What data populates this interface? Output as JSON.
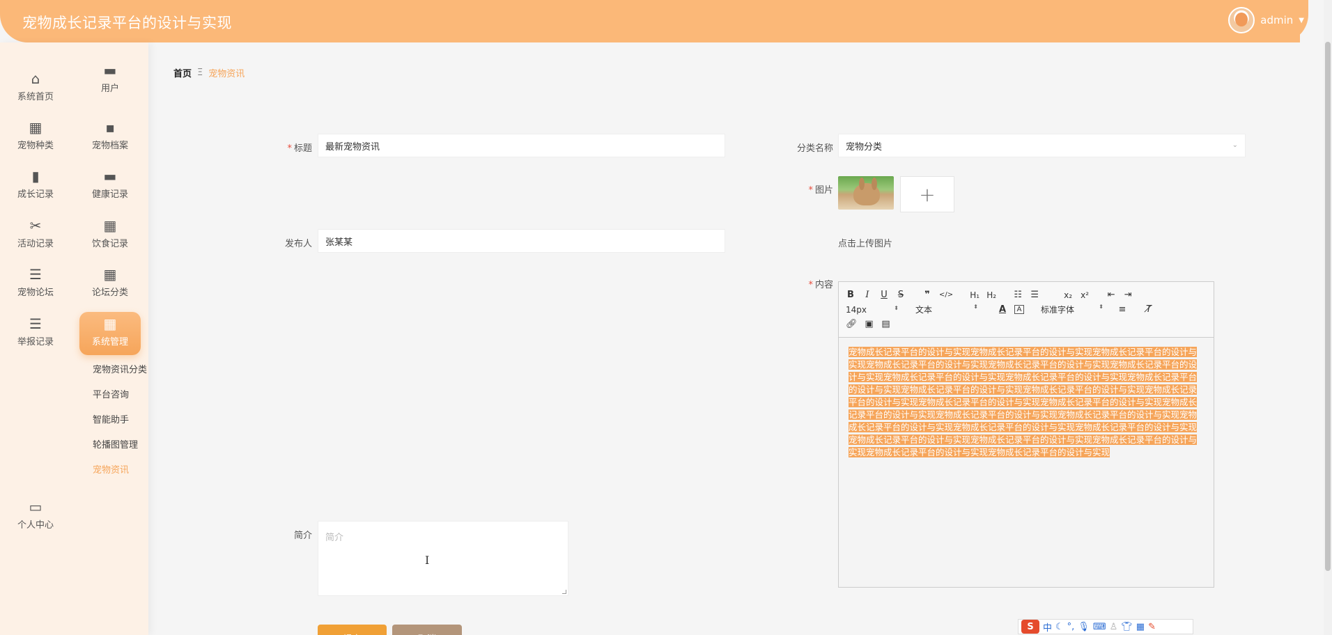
{
  "header": {
    "title": "宠物成长记录平台的设计与实现",
    "user": "admin"
  },
  "sidebar": {
    "items": [
      {
        "label": "系统首页",
        "icon": "home-icon",
        "glyph": "⌂"
      },
      {
        "label": "用户",
        "icon": "monitor-icon",
        "glyph": "▬"
      },
      {
        "label": "宠物种类",
        "icon": "grid-icon",
        "glyph": "▦"
      },
      {
        "label": "宠物档案",
        "icon": "chat-icon",
        "glyph": "▪"
      },
      {
        "label": "成长记录",
        "icon": "clipboard-icon",
        "glyph": "▮"
      },
      {
        "label": "健康记录",
        "icon": "briefcase-icon",
        "glyph": "▬"
      },
      {
        "label": "活动记录",
        "icon": "ticket-icon",
        "glyph": "✂"
      },
      {
        "label": "饮食记录",
        "icon": "apps-icon",
        "glyph": "▦"
      },
      {
        "label": "宠物论坛",
        "icon": "sliders-icon",
        "glyph": "☰"
      },
      {
        "label": "论坛分类",
        "icon": "apps-icon",
        "glyph": "▦"
      },
      {
        "label": "举报记录",
        "icon": "list-icon",
        "glyph": "☰"
      },
      {
        "label": "系统管理",
        "icon": "apps-icon",
        "glyph": "▦"
      },
      {
        "label": "个人中心",
        "icon": "wallet-icon",
        "glyph": "▭"
      }
    ],
    "sub_items": [
      "宠物资讯分类",
      "平台咨询",
      "智能助手",
      "轮播图管理",
      "宠物资讯"
    ]
  },
  "breadcrumb": {
    "home": "首页",
    "sep": "Ξ",
    "current": "宠物资讯"
  },
  "form": {
    "title_label": "标题",
    "title_value": "最新宠物资讯",
    "category_label": "分类名称",
    "category_value": "宠物分类",
    "image_label": "图片",
    "upload_plus": "+",
    "upload_hint": "点击上传图片",
    "publisher_label": "发布人",
    "publisher_value": "张某某",
    "content_label": "内容",
    "summary_label": "简介",
    "summary_placeholder": "简介",
    "submit_label": "提交",
    "cancel_label": "取消"
  },
  "editor": {
    "font_size": "14px",
    "paragraph": "文本",
    "font_family": "标准字体",
    "content": "宠物成长记录平台的设计与实现宠物成长记录平台的设计与实现宠物成长记录平台的设计与实现宠物成长记录平台的设计与实现宠物成长记录平台的设计与实现宠物成长记录平台的设计与实现宠物成长记录平台的设计与实现宠物成长记录平台的设计与实现宠物成长记录平台的设计与实现宠物成长记录平台的设计与实现宠物成长记录平台的设计与实现宠物成长记录平台的设计与实现宠物成长记录平台的设计与实现宠物成长记录平台的设计与实现宠物成长记录平台的设计与实现宠物成长记录平台的设计与实现宠物成长记录平台的设计与实现宠物成长记录平台的设计与实现宠物成长记录平台的设计与实现宠物成长记录平台的设计与实现宠物成长记录平台的设计与实现宠物成长记录平台的设计与实现宠物成长记录平台的设计与实现宠物成长记录平台的设计与实现宠物成长记录平台的设计与实现"
  },
  "ime": {
    "logo": "S",
    "lang": "中"
  },
  "colors": {
    "accent": "#f6a55a",
    "header": "#fbb878",
    "submit": "#f0a036",
    "cancel": "#b3957a"
  }
}
